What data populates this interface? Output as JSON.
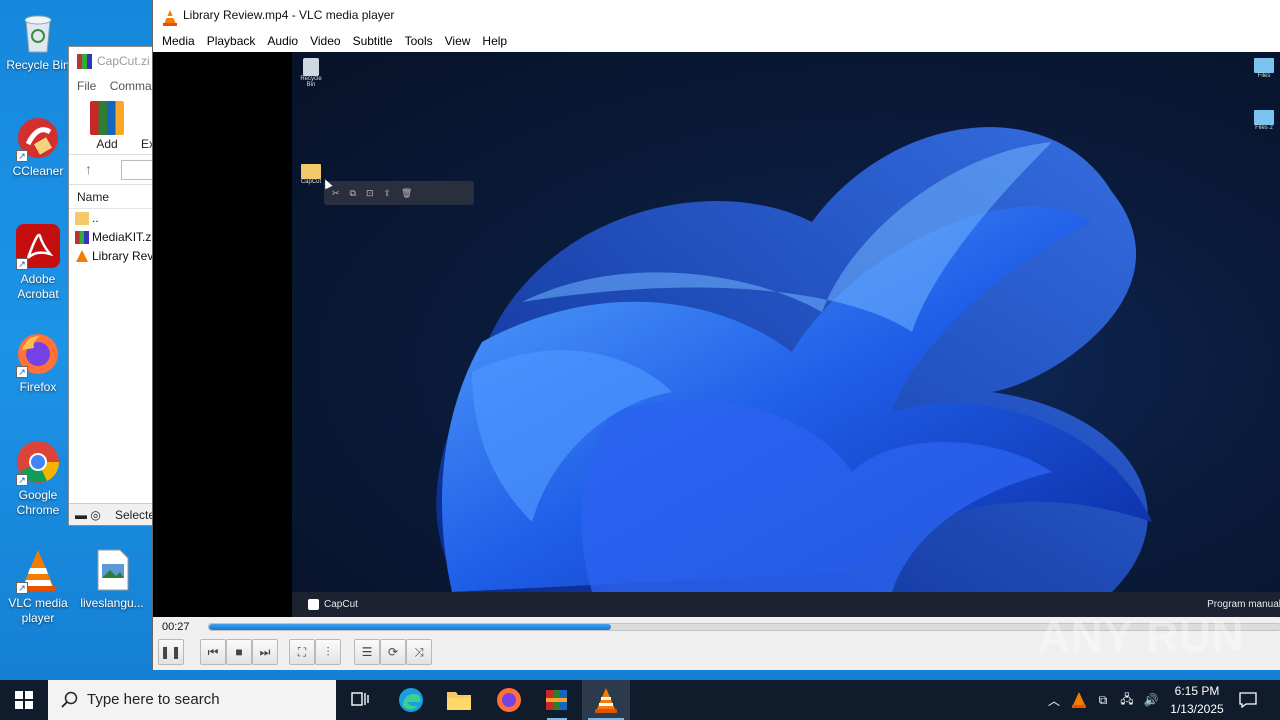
{
  "desktop": {
    "icons": [
      {
        "label": "Recycle Bin",
        "icon": "recycle-bin-icon"
      },
      {
        "label": "CCleaner",
        "icon": "ccleaner-icon"
      },
      {
        "label": "Adobe Acrobat",
        "icon": "adobe-acrobat-icon"
      },
      {
        "label": "Firefox",
        "icon": "firefox-icon"
      },
      {
        "label": "Google Chrome",
        "icon": "chrome-icon"
      },
      {
        "label": "VLC media player",
        "icon": "vlc-icon"
      },
      {
        "label": "liveslangu...",
        "icon": "image-file-icon"
      }
    ]
  },
  "winrar": {
    "title": "CapCut.zi",
    "menu": [
      "File",
      "Comma"
    ],
    "toolbar": {
      "add": "Add",
      "extract": "Ex"
    },
    "column_name": "Name",
    "rows": [
      "..",
      "MediaKIT.zi",
      "Library Revi"
    ],
    "status": "Selecte"
  },
  "vlc": {
    "title": "Library Review.mp4 - VLC media player",
    "menu": [
      "Media",
      "Playback",
      "Audio",
      "Video",
      "Subtitle",
      "Tools",
      "View",
      "Help"
    ],
    "video": {
      "desktop_icons": [
        "Recycle Bin",
        "CapCut",
        "Files",
        "Files 2"
      ],
      "taskbar_app": "CapCut",
      "taskbar_right": "Program manual"
    },
    "time_elapsed": "00:27",
    "progress_fraction": 0.375
  },
  "taskbar": {
    "search_placeholder": "Type here to search",
    "time": "6:15 PM",
    "date": "1/13/2025"
  },
  "watermark": "ANY RUN"
}
